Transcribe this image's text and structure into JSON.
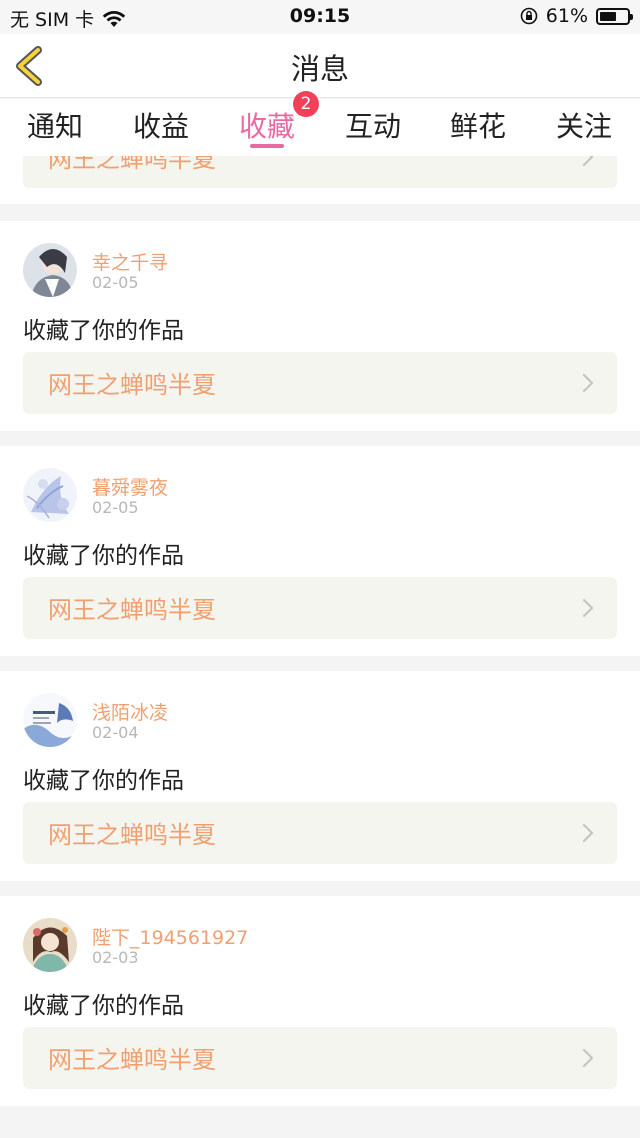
{
  "status_bar": {
    "carrier": "无 SIM 卡",
    "time": "09:15",
    "battery_percent": "61%",
    "battery_level": 0.61
  },
  "header": {
    "title": "消息",
    "back_icon": "chevron-left-icon"
  },
  "tabs": {
    "items": [
      {
        "label": "通知"
      },
      {
        "label": "收益"
      },
      {
        "label": "收藏"
      },
      {
        "label": "互动"
      },
      {
        "label": "鲜花"
      },
      {
        "label": "关注"
      }
    ],
    "active_index": 2,
    "badge": "2"
  },
  "colors": {
    "accent_pink": "#e86aa3",
    "badge_red": "#f2405a",
    "name_orange": "#f0a070",
    "work_box_bg": "#f5f5f0"
  },
  "partial_item": {
    "work_title": "网王之蝉鸣半夏"
  },
  "items": [
    {
      "username": "幸之千寻",
      "date": "02-05",
      "action": "收藏了你的作品",
      "work_title": "网王之蝉鸣半夏"
    },
    {
      "username": "暮舜雾夜",
      "date": "02-05",
      "action": "收藏了你的作品",
      "work_title": "网王之蝉鸣半夏"
    },
    {
      "username": "浅陌冰凌",
      "date": "02-04",
      "action": "收藏了你的作品",
      "work_title": "网王之蝉鸣半夏"
    },
    {
      "username": "陛下_194561927",
      "date": "02-03",
      "action": "收藏了你的作品",
      "work_title": "网王之蝉鸣半夏"
    }
  ]
}
